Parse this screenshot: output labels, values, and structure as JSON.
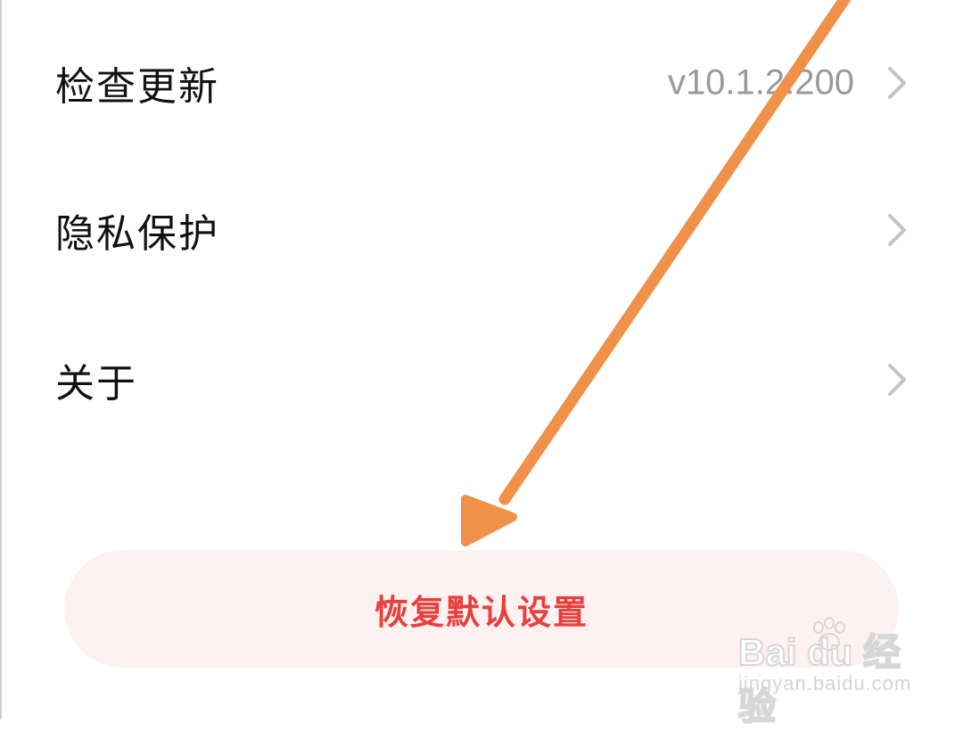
{
  "settings_list": {
    "items": [
      {
        "label": "检查更新",
        "value": "v10.1.2.200"
      },
      {
        "label": "隐私保护",
        "value": ""
      },
      {
        "label": "关于",
        "value": ""
      }
    ]
  },
  "reset_button": {
    "label": "恢复默认设置"
  },
  "annotation": {
    "arrow_color": "#F0914A"
  },
  "watermark": {
    "logo_text": "Bai du 经验",
    "url": "jingyan.baidu.com"
  },
  "colors": {
    "accent_red": "#E8413D",
    "button_bg": "#FDF1F1",
    "secondary_text": "#9A9A9A"
  },
  "icons": {
    "chevron": "chevron-right-icon"
  }
}
